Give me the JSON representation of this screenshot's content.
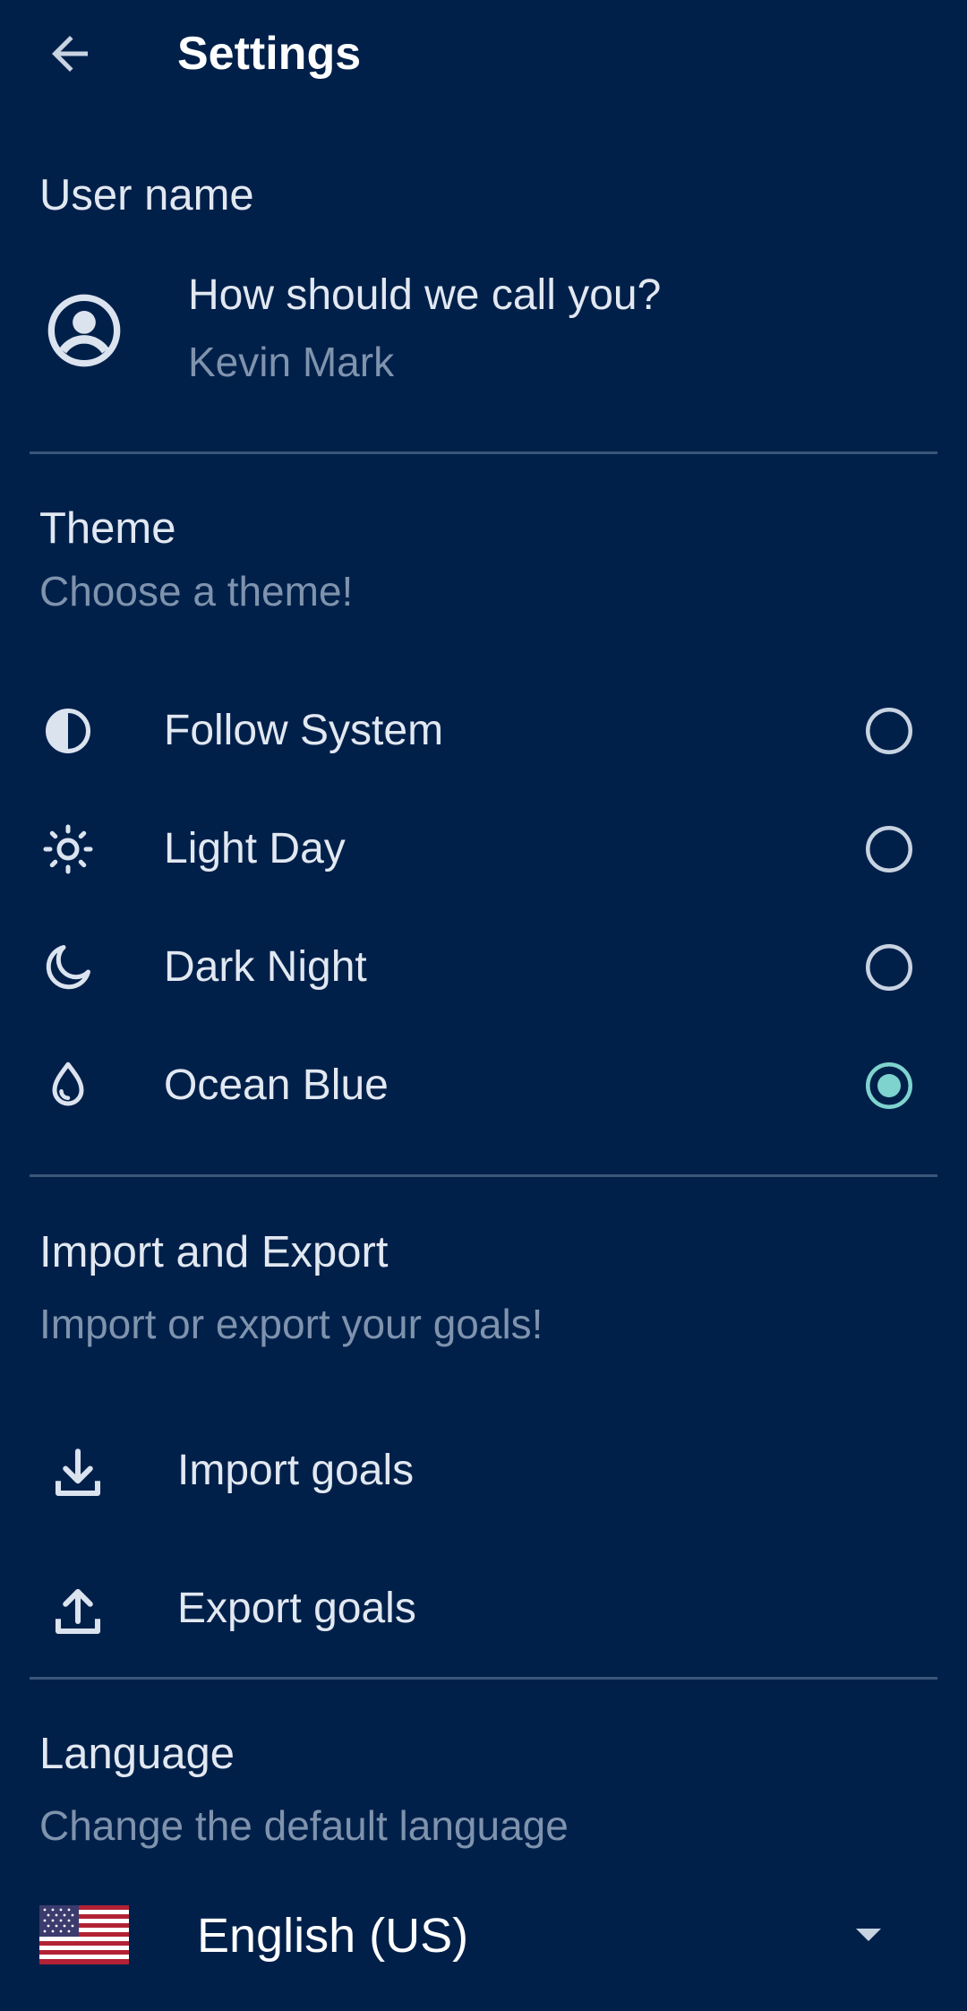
{
  "header": {
    "title": "Settings",
    "back_icon": "arrow-left-icon"
  },
  "user_section": {
    "title": "User name",
    "prompt": "How should we call you?",
    "value": "Kevin Mark",
    "icon": "account-circle-icon"
  },
  "theme_section": {
    "title": "Theme",
    "subtitle": "Choose a theme!",
    "options": [
      {
        "label": "Follow System",
        "icon": "contrast-icon",
        "selected": false
      },
      {
        "label": "Light Day",
        "icon": "sun-icon",
        "selected": false
      },
      {
        "label": "Dark Night",
        "icon": "moon-icon",
        "selected": false
      },
      {
        "label": "Ocean Blue",
        "icon": "water-drop-icon",
        "selected": true
      }
    ]
  },
  "import_export_section": {
    "title": "Import and Export",
    "subtitle": "Import or export your goals!",
    "import_label": "Import goals",
    "export_label": "Export goals"
  },
  "language_section": {
    "title": "Language",
    "subtitle": "Change the default language",
    "selected": "English (US)",
    "flag": "us-flag-icon"
  },
  "colors": {
    "background": "#00204a",
    "accent": "#7fd3cf",
    "divider": "#3a5678",
    "muted_text": "#7f93ad"
  }
}
